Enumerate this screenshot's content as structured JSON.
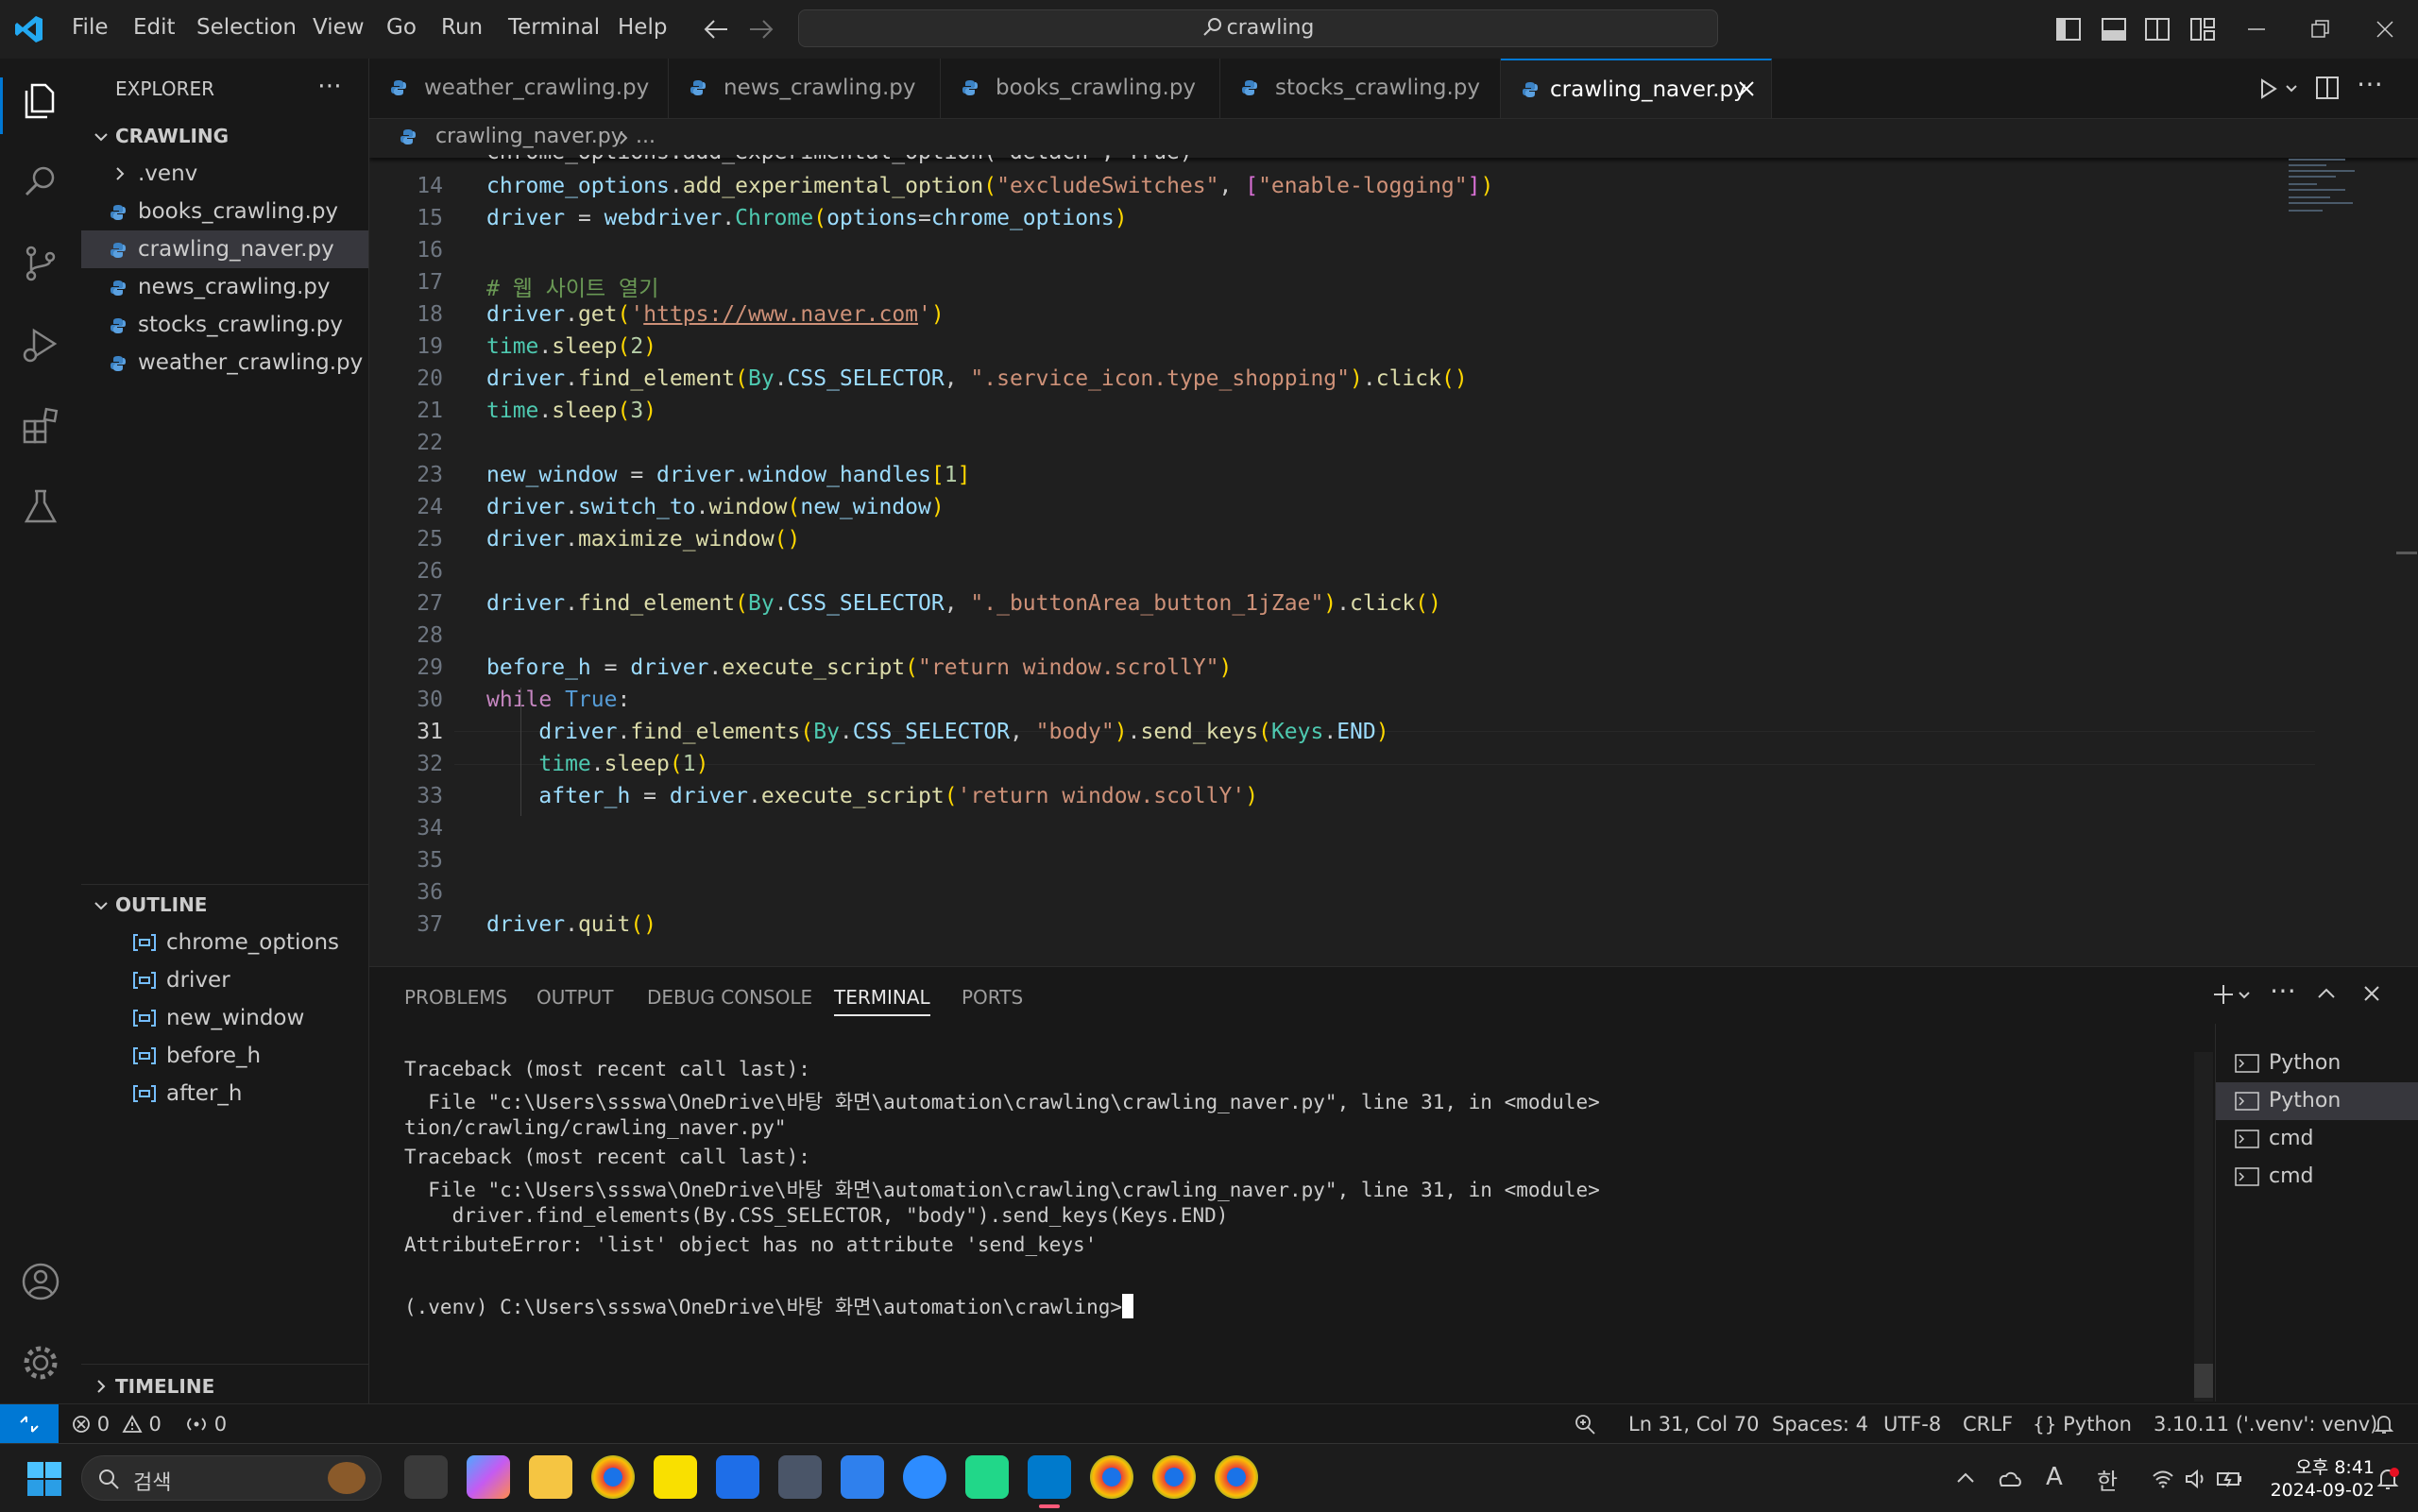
{
  "menu": [
    "File",
    "Edit",
    "Selection",
    "View",
    "Go",
    "Run",
    "Terminal",
    "Help"
  ],
  "search": {
    "text": "crawling"
  },
  "explorer": {
    "title": "EXPLORER",
    "folder": "CRAWLING",
    "items": [
      {
        "label": ".venv",
        "type": "folder"
      },
      {
        "label": "books_crawling.py",
        "type": "py"
      },
      {
        "label": "crawling_naver.py",
        "type": "py",
        "selected": true
      },
      {
        "label": "news_crawling.py",
        "type": "py"
      },
      {
        "label": "stocks_crawling.py",
        "type": "py"
      },
      {
        "label": "weather_crawling.py",
        "type": "py"
      }
    ]
  },
  "outline": {
    "title": "OUTLINE",
    "items": [
      "chrome_options",
      "driver",
      "new_window",
      "before_h",
      "after_h"
    ]
  },
  "timeline": {
    "title": "TIMELINE"
  },
  "tabs": [
    {
      "label": "weather_crawling.py"
    },
    {
      "label": "news_crawling.py"
    },
    {
      "label": "books_crawling.py"
    },
    {
      "label": "stocks_crawling.py"
    },
    {
      "label": "crawling_naver.py",
      "active": true
    }
  ],
  "breadcrumb": {
    "file": "crawling_naver.py",
    "more": "..."
  },
  "editor": {
    "partial_line": "chrome_options.add_experimental_option(\"detach\", True)",
    "line_numbers": [
      "14",
      "15",
      "16",
      "17",
      "18",
      "19",
      "20",
      "21",
      "22",
      "23",
      "24",
      "25",
      "26",
      "27",
      "28",
      "29",
      "30",
      "31",
      "32",
      "33",
      "34",
      "35",
      "36",
      "37"
    ],
    "current_line": "31"
  },
  "panel": {
    "tabs": [
      "PROBLEMS",
      "OUTPUT",
      "DEBUG CONSOLE",
      "TERMINAL",
      "PORTS"
    ],
    "active_tab": "TERMINAL",
    "terminal_lines": [
      "Traceback (most recent call last):",
      "  File \"c:\\Users\\ssswa\\OneDrive\\바탕 화면\\automation\\crawling\\crawling_naver.py\", line 31, in <module>",
      "tion/crawling/crawling_naver.py\"",
      "Traceback (most recent call last):",
      "  File \"c:\\Users\\ssswa\\OneDrive\\바탕 화면\\automation\\crawling\\crawling_naver.py\", line 31, in <module>",
      "    driver.find_elements(By.CSS_SELECTOR, \"body\").send_keys(Keys.END)",
      "AttributeError: 'list' object has no attribute 'send_keys'",
      "",
      "(.venv) C:\\Users\\ssswa\\OneDrive\\바탕 화면\\automation\\crawling>"
    ],
    "terminals": [
      "Python",
      "Python",
      "cmd",
      "cmd"
    ]
  },
  "status": {
    "errors": "0",
    "warnings": "0",
    "ports": "0",
    "position": "Ln 31, Col 70",
    "spaces": "Spaces: 4",
    "encoding": "UTF-8",
    "eol": "CRLF",
    "language": "Python",
    "interpreter": "3.10.11 ('.venv': venv)"
  },
  "taskbar": {
    "search_placeholder": "검색",
    "time": "오후 8:41",
    "date": "2024-09-02",
    "ime_a": "A",
    "ime_ko": "한"
  },
  "colors": {
    "accent": "#0078d4",
    "bg": "#1f1f1f",
    "sidebar": "#181818"
  }
}
